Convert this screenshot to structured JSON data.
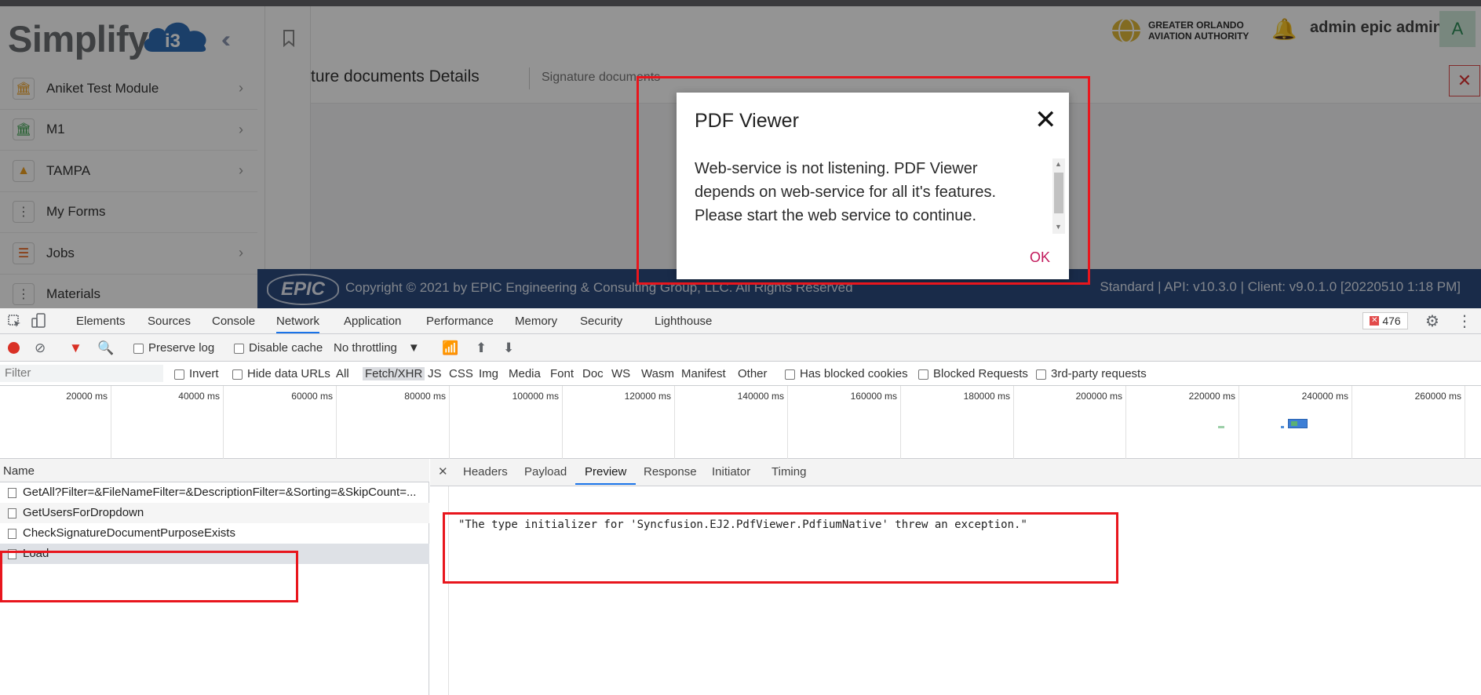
{
  "app": {
    "logo_text": "Simplify",
    "logo_badge": "i3",
    "sidebar_items": [
      {
        "label": "Aniket Test Module",
        "icon": "bank-icon",
        "glyph": "🏛",
        "color": "#f0a020",
        "chevron": true
      },
      {
        "label": "M1",
        "icon": "bank-icon",
        "glyph": "🏛",
        "color": "#2f9e44",
        "chevron": true
      },
      {
        "label": "TAMPA",
        "icon": "tampa-icon",
        "glyph": "▲",
        "color": "#f0a020",
        "chevron": true
      },
      {
        "label": "My Forms",
        "icon": "dots-vertical-icon",
        "glyph": "⋮",
        "color": "#666666",
        "chevron": false
      },
      {
        "label": "Jobs",
        "icon": "sliders-icon",
        "glyph": "☰",
        "color": "#e8590c",
        "chevron": true
      },
      {
        "label": "Materials",
        "icon": "dots-vertical-icon",
        "glyph": "⋮",
        "color": "#666666",
        "chevron": false
      }
    ],
    "authority_line1": "GREATER ORLANDO",
    "authority_line2": "AVIATION AUTHORITY",
    "user_name": "admin epic admin",
    "avatar_letter": "A",
    "page_title": "ture documents Details",
    "breadcrumb": "Signature documents",
    "footer_logo": "EPIC",
    "footer_copyright": "Copyright © 2021 by EPIC Engineering & Consulting Group, LLC. All Rights Reserved",
    "footer_version": "Standard | API: v10.3.0 | Client: v9.0.1.0 [20220510 1:18 PM]"
  },
  "modal": {
    "title": "PDF Viewer",
    "message": "Web-service is not listening. PDF Viewer depends on web-service for all it's features. Please start the web service to continue.",
    "ok_label": "OK"
  },
  "devtools": {
    "tabs": [
      "Elements",
      "Sources",
      "Console",
      "Network",
      "Application",
      "Performance",
      "Memory",
      "Security",
      "Lighthouse"
    ],
    "active_tab": "Network",
    "error_count": "476",
    "toolbar": {
      "preserve_log": "Preserve log",
      "disable_cache": "Disable cache",
      "throttling": "No throttling"
    },
    "filter": {
      "placeholder": "Filter",
      "invert": "Invert",
      "hide_data_urls": "Hide data URLs",
      "types": [
        "All",
        "Fetch/XHR",
        "JS",
        "CSS",
        "Img",
        "Media",
        "Font",
        "Doc",
        "WS",
        "Wasm",
        "Manifest",
        "Other"
      ],
      "active_type": "Fetch/XHR",
      "has_blocked_cookies": "Has blocked cookies",
      "blocked_requests": "Blocked Requests",
      "third_party": "3rd-party requests"
    },
    "timeline_ticks": [
      "20000 ms",
      "40000 ms",
      "60000 ms",
      "80000 ms",
      "100000 ms",
      "120000 ms",
      "140000 ms",
      "160000 ms",
      "180000 ms",
      "200000 ms",
      "220000 ms",
      "240000 ms",
      "260000 ms"
    ],
    "name_header": "Name",
    "requests": [
      "GetAll?Filter=&FileNameFilter=&DescriptionFilter=&Sorting=&SkipCount=...",
      "GetUsersForDropdown",
      "CheckSignatureDocumentPurposeExists",
      "Load"
    ],
    "selected_request": "Load",
    "detail_tabs": [
      "Headers",
      "Payload",
      "Preview",
      "Response",
      "Initiator",
      "Timing"
    ],
    "active_detail_tab": "Preview",
    "preview_text": "\"The type initializer for 'Syncfusion.EJ2.PdfViewer.PdfiumNative' threw an exception.\""
  },
  "colors": {
    "brand_blue": "#2b4a7e",
    "accent_red": "#e8161d",
    "ok_pink": "#c2185b",
    "devtools_blue": "#1a73e8"
  }
}
